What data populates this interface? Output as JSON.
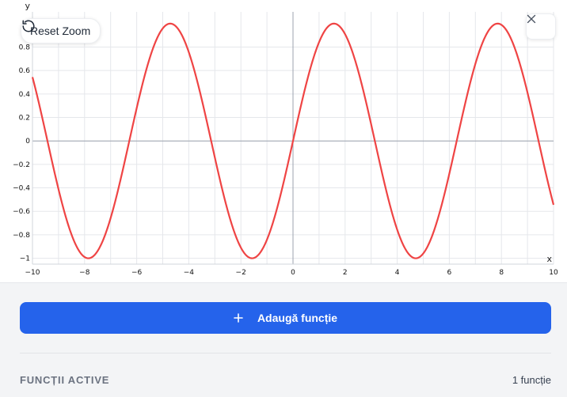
{
  "toolbar": {
    "reset_zoom_label": "Reset Zoom",
    "reset_zoom_icon": "rotate-ccw-icon",
    "close_icon": "close-icon"
  },
  "chart_data": {
    "type": "line",
    "function": "sin(x)",
    "xlabel": "x",
    "ylabel": "y",
    "xlim": [
      -10,
      10
    ],
    "ylim": [
      -1.05,
      1.1
    ],
    "x_ticks": [
      -10,
      -8,
      -6,
      -4,
      -2,
      0,
      2,
      4,
      6,
      8,
      10
    ],
    "x_tick_labels": [
      "−10",
      "−8",
      "−6",
      "−4",
      "−2",
      "0",
      "2",
      "4",
      "6",
      "8",
      "10"
    ],
    "y_ticks": [
      -1,
      -0.8,
      -0.6,
      -0.4,
      -0.2,
      0,
      0.2,
      0.4,
      0.6,
      0.8
    ],
    "y_tick_labels": [
      "−1",
      "−0.8",
      "−0.6",
      "−0.4",
      "−0.2",
      "0",
      "0.2",
      "0.4",
      "0.6",
      "0.8"
    ],
    "grid": true,
    "line_color": "#ef4444",
    "grid_color": "#e5e7eb",
    "axis_color": "#9ca3af"
  },
  "actions": {
    "add_function_label": "Adaugă funcție",
    "add_function_icon": "plus-icon"
  },
  "active_functions": {
    "title": "FUNCȚII ACTIVE",
    "count_label": "1 funcție"
  },
  "colors": {
    "accent": "#2563eb",
    "panel_bg": "#f3f4f6"
  }
}
